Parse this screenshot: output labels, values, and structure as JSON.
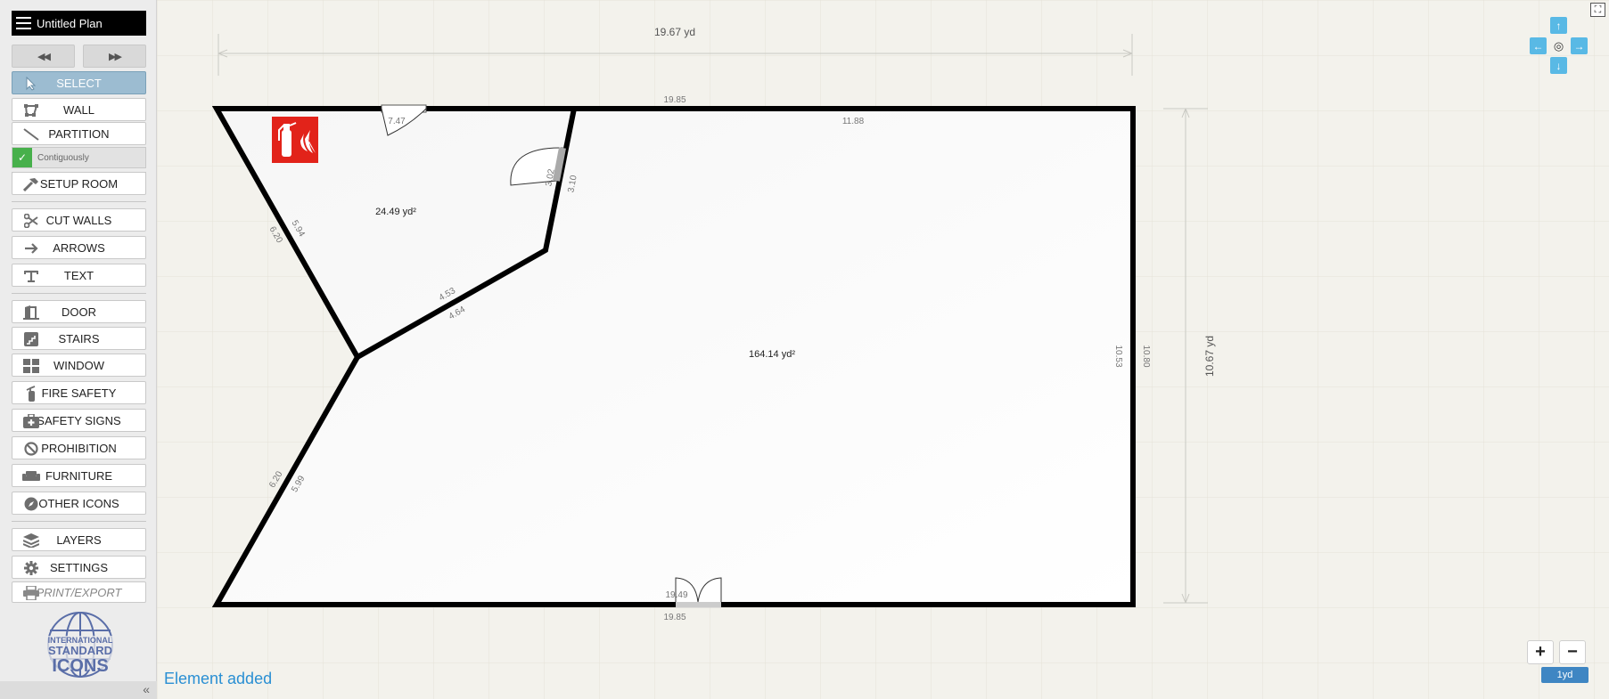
{
  "app": {
    "title": "Untitled Plan"
  },
  "nav": {
    "back": "◀◀",
    "forward": "▶▶"
  },
  "tools": [
    {
      "label": "SELECT"
    },
    {
      "label": "WALL"
    },
    {
      "label": "PARTITION"
    },
    {
      "label": "SETUP ROOM"
    },
    {
      "label": "CUT WALLS"
    },
    {
      "label": "ARROWS"
    },
    {
      "label": "TEXT"
    },
    {
      "label": "DOOR"
    },
    {
      "label": "STAIRS"
    },
    {
      "label": "WINDOW"
    },
    {
      "label": "FIRE SAFETY"
    },
    {
      "label": "SAFETY SIGNS"
    },
    {
      "label": "PROHIBITION"
    },
    {
      "label": "FURNITURE"
    },
    {
      "label": "OTHER ICONS"
    },
    {
      "label": "LAYERS"
    },
    {
      "label": "SETTINGS"
    },
    {
      "label": "PRINT/EXPORT"
    }
  ],
  "contiguously": {
    "label": "Contiguously",
    "checked": true,
    "check": "✓"
  },
  "logo": {
    "line1": "INTERNATIONAL",
    "line2": "STANDARD",
    "line3": "ICONS"
  },
  "collapse": "«",
  "status": "Element added",
  "plan": {
    "overall_width": "19.67 yd",
    "overall_height": "10.67 yd",
    "small_room_area": "24.49 yd²",
    "large_room_area": "164.14 yd²",
    "dims": {
      "top_outer": "19.85",
      "top_inner": "11.88",
      "window_top": "7.47",
      "door_a": "3.02",
      "door_b": "3.10",
      "diag_upper_a": "5.94",
      "diag_upper_b": "6.20",
      "partition_a": "4.53",
      "partition_b": "4.64",
      "diag_lower_a": "6.20",
      "diag_lower_b": "5.99",
      "right_a": "10.53",
      "right_b": "10.80",
      "bottom_inner": "19.49",
      "bottom_outer": "19.85"
    }
  },
  "controls": {
    "up": "↑",
    "down": "↓",
    "left": "←",
    "right": "→",
    "center": "◎",
    "fullscreen": "⛶",
    "zoom_in": "+",
    "zoom_out": "−",
    "scale": "1yd"
  },
  "colors": {
    "accent": "#59b9e5",
    "active_tool": "#9cbcd1",
    "status": "#2a8fd3",
    "fire": "#e2231a"
  }
}
